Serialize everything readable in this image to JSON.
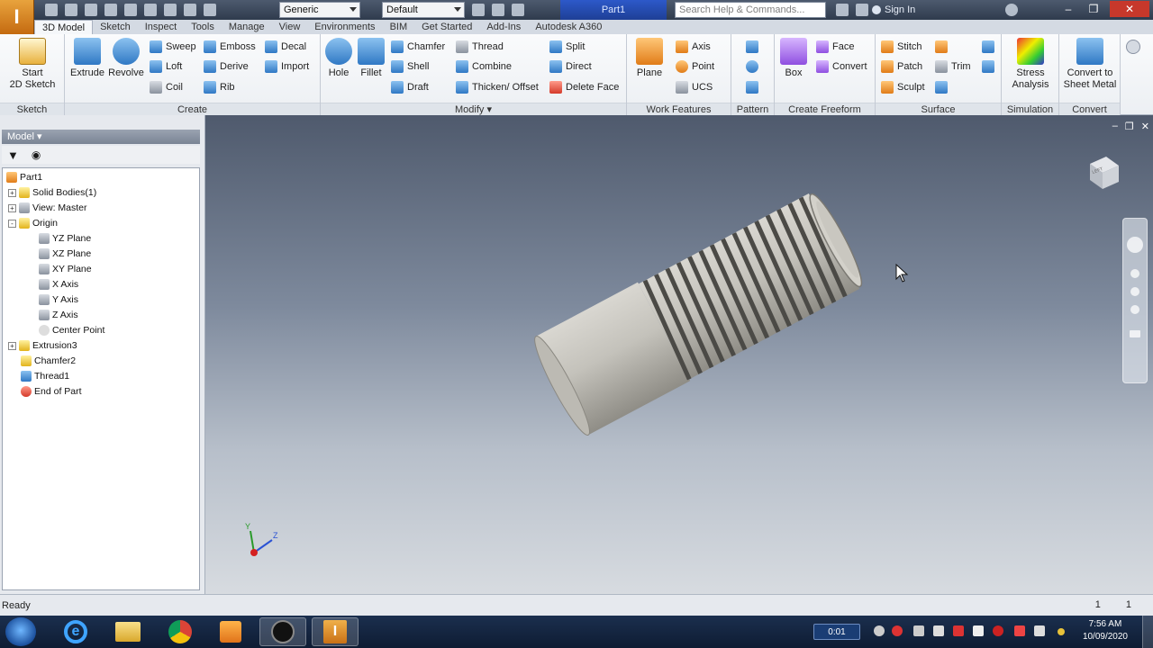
{
  "titlebar": {
    "app_glyph": "I",
    "material": "Generic",
    "appearance": "Default",
    "document": "Part1",
    "search_placeholder": "Search Help & Commands...",
    "sign_in": "Sign In"
  },
  "tabs": [
    "3D Model",
    "Sketch",
    "Inspect",
    "Tools",
    "Manage",
    "View",
    "Environments",
    "BIM",
    "Get Started",
    "Add-Ins",
    "Autodesk A360"
  ],
  "ribbon": {
    "sketch": {
      "label": "Sketch",
      "start": "Start",
      "start2": "2D Sketch"
    },
    "create": {
      "label": "Create",
      "extrude": "Extrude",
      "revolve": "Revolve",
      "sweep": "Sweep",
      "loft": "Loft",
      "coil": "Coil",
      "emboss": "Emboss",
      "derive": "Derive",
      "rib": "Rib",
      "decal": "Decal",
      "import": "Import"
    },
    "modify": {
      "label": "Modify",
      "hole": "Hole",
      "fillet": "Fillet",
      "chamfer": "Chamfer",
      "shell": "Shell",
      "draft": "Draft",
      "thread": "Thread",
      "combine": "Combine",
      "thicken": "Thicken/ Offset",
      "split": "Split",
      "direct": "Direct",
      "delete_face": "Delete Face"
    },
    "work": {
      "label": "Work Features",
      "plane": "Plane",
      "axis": "Axis",
      "point": "Point",
      "ucs": "UCS"
    },
    "pattern": {
      "label": "Pattern"
    },
    "freeform": {
      "label": "Create Freeform",
      "box": "Box",
      "face": "Face",
      "convert": "Convert"
    },
    "surface": {
      "label": "Surface",
      "stitch": "Stitch",
      "patch": "Patch",
      "sculpt": "Sculpt",
      "trim": "Trim"
    },
    "simulation": {
      "label": "Simulation",
      "stress1": "Stress",
      "stress2": "Analysis"
    },
    "convert": {
      "label": "Convert",
      "sheet1": "Convert to",
      "sheet2": "Sheet Metal"
    }
  },
  "browser": {
    "header": "Model",
    "nodes": [
      "Part1",
      "Solid Bodies(1)",
      "View: Master",
      "Origin",
      "YZ Plane",
      "XZ Plane",
      "XY Plane",
      "X Axis",
      "Y Axis",
      "Z Axis",
      "Center Point",
      "Extrusion3",
      "Chamfer2",
      "Thread1",
      "End of Part"
    ]
  },
  "viewport": {
    "viewcube_label": "LEFT",
    "triad_y": "Y",
    "triad_z": "Z"
  },
  "status": {
    "text": "Ready",
    "count1": "1",
    "count2": "1"
  },
  "taskbar": {
    "timer": "0:01",
    "time": "7:56 AM",
    "date": "10/09/2020"
  }
}
